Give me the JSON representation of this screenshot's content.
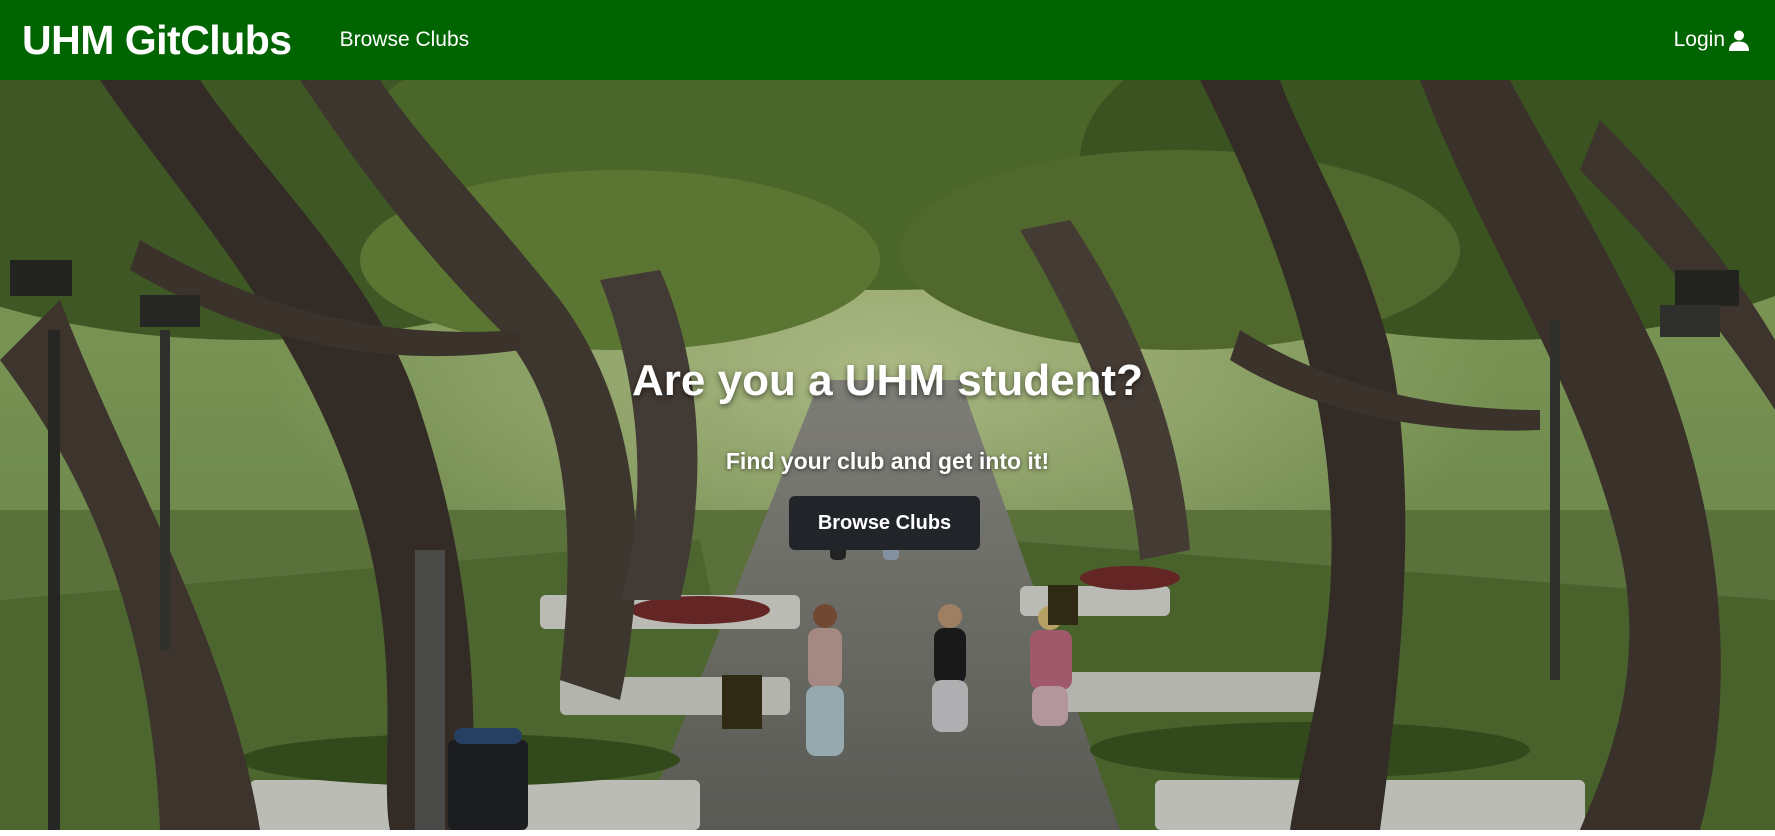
{
  "navbar": {
    "brand": "UHM GitClubs",
    "browse_label": "Browse Clubs",
    "login_label": "Login",
    "background_color": "#006400",
    "login_icon": "user-icon"
  },
  "hero": {
    "title": "Are you a UHM student?",
    "subtitle": "Find your club and get into it!",
    "button_label": "Browse Clubs",
    "button_color": "#212529",
    "background_image": "campus-walkway-under-trees-photo"
  }
}
